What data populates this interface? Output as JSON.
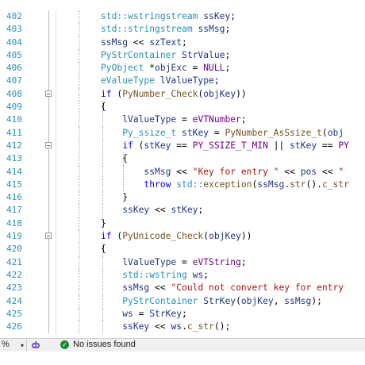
{
  "editor": {
    "lines": [
      {
        "num": "402",
        "fold": false,
        "segs": [
          [
            "ns",
            "std::"
          ],
          [
            "type",
            "wstringstream"
          ],
          [
            "",
            " "
          ],
          [
            "var",
            "ssKey"
          ],
          [
            "",
            ";"
          ]
        ]
      },
      {
        "num": "403",
        "fold": false,
        "segs": [
          [
            "ns",
            "std::"
          ],
          [
            "type",
            "stringstream"
          ],
          [
            "",
            " "
          ],
          [
            "var",
            "ssMsg"
          ],
          [
            "",
            ";"
          ]
        ]
      },
      {
        "num": "404",
        "fold": false,
        "segs": [
          [
            "var",
            "ssMsg"
          ],
          [
            "",
            " << "
          ],
          [
            "var",
            "szText"
          ],
          [
            "",
            ";"
          ]
        ]
      },
      {
        "num": "405",
        "fold": false,
        "segs": [
          [
            "type",
            "PyStrContainer"
          ],
          [
            "",
            " "
          ],
          [
            "var",
            "StrValue"
          ],
          [
            "",
            ";"
          ]
        ]
      },
      {
        "num": "406",
        "fold": false,
        "segs": [
          [
            "type",
            "PyObject"
          ],
          [
            "",
            " *"
          ],
          [
            "var",
            "objExc"
          ],
          [
            "",
            " = "
          ],
          [
            "mac",
            "NULL"
          ],
          [
            "",
            ";"
          ]
        ]
      },
      {
        "num": "407",
        "fold": false,
        "segs": [
          [
            "type",
            "eValueType"
          ],
          [
            "",
            " "
          ],
          [
            "var",
            "lValueType"
          ],
          [
            "",
            ";"
          ]
        ]
      },
      {
        "num": "408",
        "fold": true,
        "segs": [
          [
            "kw",
            "if"
          ],
          [
            "",
            " ("
          ],
          [
            "fn",
            "PyNumber_Check"
          ],
          [
            "",
            "("
          ],
          [
            "var",
            "objKey"
          ],
          [
            "",
            "))"
          ]
        ]
      },
      {
        "num": "409",
        "fold": false,
        "segs": [
          [
            "",
            "{"
          ]
        ]
      },
      {
        "num": "410",
        "fold": false,
        "segs": [
          [
            "",
            "    "
          ],
          [
            "var",
            "lValueType"
          ],
          [
            "",
            " = "
          ],
          [
            "mac",
            "eVTNumber"
          ],
          [
            "",
            ";"
          ]
        ]
      },
      {
        "num": "411",
        "fold": false,
        "segs": [
          [
            "",
            "    "
          ],
          [
            "type",
            "Py_ssize_t"
          ],
          [
            "",
            " "
          ],
          [
            "var",
            "stKey"
          ],
          [
            "",
            " = "
          ],
          [
            "fn",
            "PyNumber_AsSsize_t"
          ],
          [
            "",
            "("
          ],
          [
            "var",
            "obj"
          ]
        ]
      },
      {
        "num": "412",
        "fold": true,
        "segs": [
          [
            "",
            "    "
          ],
          [
            "kw",
            "if"
          ],
          [
            "",
            " ("
          ],
          [
            "var",
            "stKey"
          ],
          [
            "",
            " == "
          ],
          [
            "mac",
            "PY_SSIZE_T_MIN"
          ],
          [
            "",
            " || "
          ],
          [
            "var",
            "stKey"
          ],
          [
            "",
            " == "
          ],
          [
            "mac",
            "PY"
          ]
        ]
      },
      {
        "num": "413",
        "fold": false,
        "segs": [
          [
            "",
            "    {"
          ]
        ]
      },
      {
        "num": "414",
        "fold": false,
        "segs": [
          [
            "",
            "        "
          ],
          [
            "var",
            "ssMsg"
          ],
          [
            "",
            " << "
          ],
          [
            "str",
            "\"Key for entry \""
          ],
          [
            "",
            " << "
          ],
          [
            "var",
            "pos"
          ],
          [
            "",
            " << "
          ],
          [
            "str",
            "\""
          ]
        ]
      },
      {
        "num": "415",
        "fold": false,
        "segs": [
          [
            "",
            "        "
          ],
          [
            "kw",
            "throw"
          ],
          [
            "",
            " "
          ],
          [
            "ns",
            "std::"
          ],
          [
            "fn",
            "exception"
          ],
          [
            "",
            "("
          ],
          [
            "var",
            "ssMsg"
          ],
          [
            "",
            "."
          ],
          [
            "fn",
            "str"
          ],
          [
            "",
            "()."
          ],
          [
            "fn",
            "c_str"
          ]
        ]
      },
      {
        "num": "416",
        "fold": false,
        "segs": [
          [
            "",
            "    }"
          ]
        ]
      },
      {
        "num": "417",
        "fold": false,
        "segs": [
          [
            "",
            "    "
          ],
          [
            "var",
            "ssKey"
          ],
          [
            "",
            " << "
          ],
          [
            "var",
            "stKey"
          ],
          [
            "",
            ";"
          ]
        ]
      },
      {
        "num": "418",
        "fold": false,
        "segs": [
          [
            "",
            "}"
          ]
        ]
      },
      {
        "num": "419",
        "fold": true,
        "segs": [
          [
            "kw",
            "if"
          ],
          [
            "",
            " ("
          ],
          [
            "fn",
            "PyUnicode_Check"
          ],
          [
            "",
            "("
          ],
          [
            "var",
            "objKey"
          ],
          [
            "",
            "))"
          ]
        ]
      },
      {
        "num": "420",
        "fold": false,
        "segs": [
          [
            "",
            "{"
          ]
        ]
      },
      {
        "num": "421",
        "fold": false,
        "segs": [
          [
            "",
            "    "
          ],
          [
            "var",
            "lValueType"
          ],
          [
            "",
            " = "
          ],
          [
            "mac",
            "eVTString"
          ],
          [
            "",
            ";"
          ]
        ]
      },
      {
        "num": "422",
        "fold": false,
        "segs": [
          [
            "",
            "    "
          ],
          [
            "ns",
            "std::"
          ],
          [
            "type",
            "wstring"
          ],
          [
            "",
            " "
          ],
          [
            "var",
            "ws"
          ],
          [
            "",
            ";"
          ]
        ]
      },
      {
        "num": "423",
        "fold": false,
        "segs": [
          [
            "",
            "    "
          ],
          [
            "var",
            "ssMsg"
          ],
          [
            "",
            " << "
          ],
          [
            "str",
            "\"Could not convert key for entry"
          ]
        ]
      },
      {
        "num": "424",
        "fold": false,
        "segs": [
          [
            "",
            "    "
          ],
          [
            "type",
            "PyStrContainer"
          ],
          [
            "",
            " "
          ],
          [
            "var",
            "StrKey"
          ],
          [
            "",
            "("
          ],
          [
            "var",
            "objKey"
          ],
          [
            "",
            ", "
          ],
          [
            "var",
            "ssMsg"
          ],
          [
            "",
            ");"
          ]
        ]
      },
      {
        "num": "425",
        "fold": false,
        "segs": [
          [
            "",
            "    "
          ],
          [
            "var",
            "ws"
          ],
          [
            "",
            " = "
          ],
          [
            "var",
            "StrKey"
          ],
          [
            "",
            ";"
          ]
        ]
      },
      {
        "num": "426",
        "fold": false,
        "segs": [
          [
            "",
            "    "
          ],
          [
            "var",
            "ssKey"
          ],
          [
            "",
            " << "
          ],
          [
            "var",
            "ws"
          ],
          [
            "",
            "."
          ],
          [
            "fn",
            "c_str"
          ],
          [
            "",
            "();"
          ]
        ]
      }
    ]
  },
  "statusbar": {
    "zoom_value": "%",
    "zoom_caret": "▾",
    "issues_label": "No issues found",
    "issues_check": "✓"
  },
  "colors": {
    "line_number": "#2b91af",
    "keyword": "#0000ff",
    "string": "#a31515",
    "type": "#2b91af",
    "function": "#74531f",
    "variable": "#1f377f",
    "macro": "#6f008a",
    "issues_ok": "#1f8a35"
  },
  "icons": {
    "copilot": "copilot-icon",
    "issues": "check-circle-icon",
    "fold": "collapse-minus-icon"
  }
}
